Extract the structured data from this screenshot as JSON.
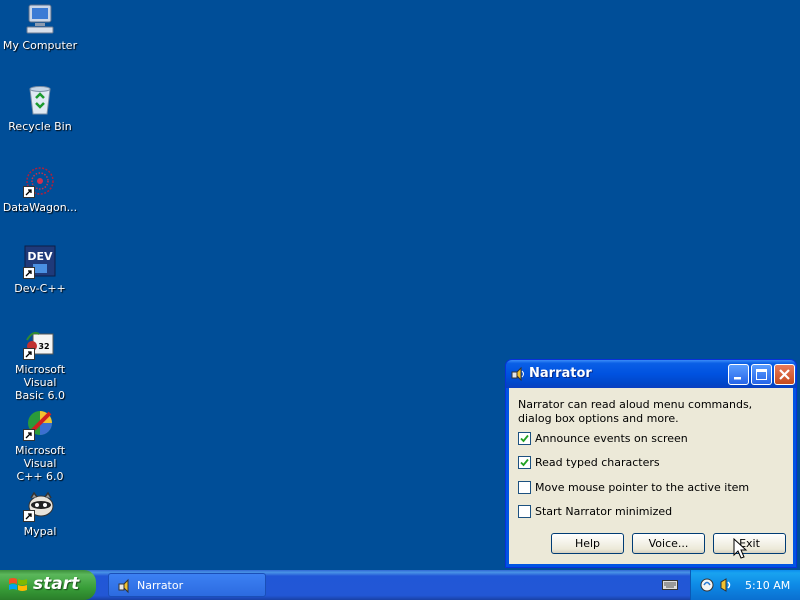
{
  "desktop": {
    "icons": [
      {
        "label": "My Computer",
        "icon": "my-computer-icon"
      },
      {
        "label": "Recycle Bin",
        "icon": "recycle-bin-icon"
      },
      {
        "label": "DataWagon...",
        "icon": "datawagon-icon"
      },
      {
        "label": "Dev-C++",
        "icon": "dev-cpp-icon"
      },
      {
        "label": "Microsoft Visual\nBasic 6.0",
        "icon": "visual-basic-icon"
      },
      {
        "label": "Microsoft Visual\nC++ 6.0",
        "icon": "visual-cpp-icon"
      },
      {
        "label": "Mypal",
        "icon": "mypal-icon"
      }
    ],
    "background_color": "#004e98"
  },
  "narrator": {
    "title": "Narrator",
    "description": "Narrator can read aloud menu commands, dialog box options and more.",
    "options": [
      {
        "label": "Announce events on screen",
        "checked": true
      },
      {
        "label": "Read typed characters",
        "checked": true
      },
      {
        "label": "Move mouse pointer to the active item",
        "checked": false
      },
      {
        "label": "Start Narrator minimized",
        "checked": false
      }
    ],
    "buttons": {
      "help": "Help",
      "voice": "Voice...",
      "exit": "Exit"
    }
  },
  "taskbar": {
    "start_label": "start",
    "task_label": "Narrator",
    "clock": "5:10 AM"
  }
}
